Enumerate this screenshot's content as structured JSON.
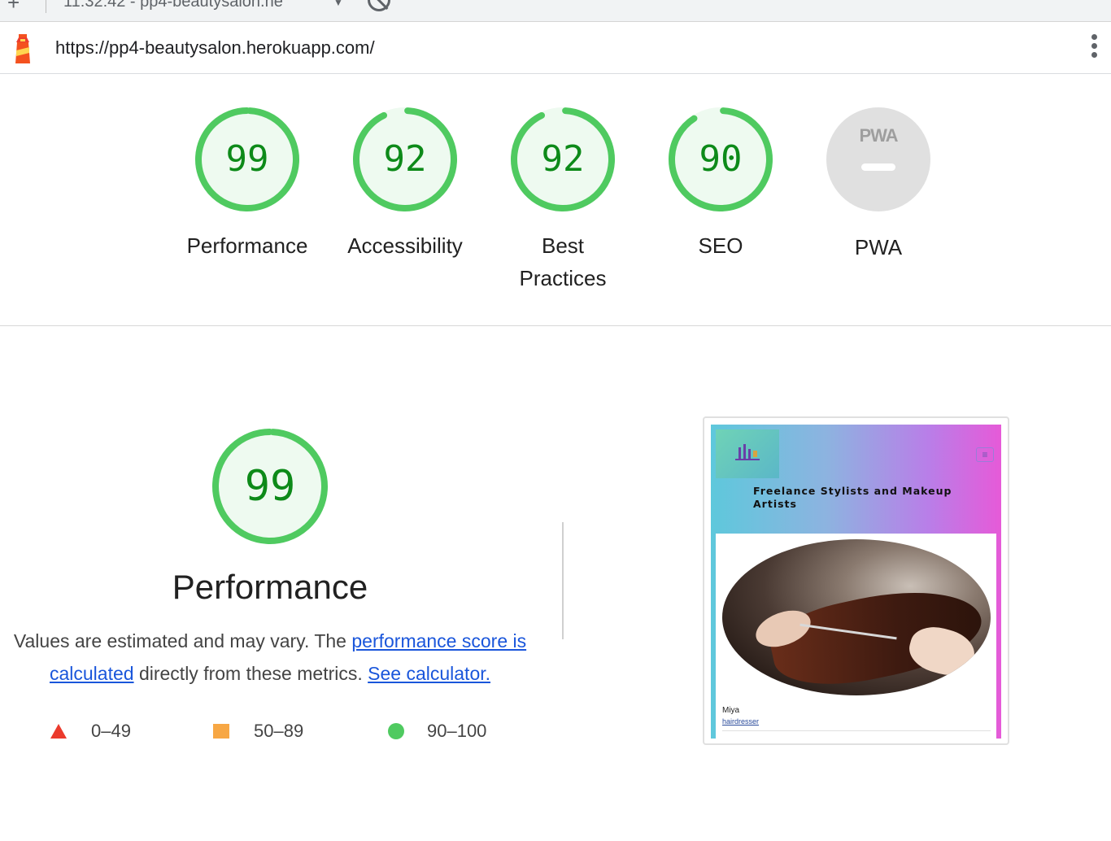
{
  "browser": {
    "tab_title": "11:32:42 - pp4-beautysalon.he",
    "new_tab_symbol": "+",
    "caret_symbol": "▼",
    "url": "https://pp4-beautysalon.herokuapp.com/",
    "icons": {
      "logo": "lighthouse-icon",
      "menu": "more-vert-icon",
      "blocked": "block-icon"
    }
  },
  "categories": [
    {
      "label": "Performance",
      "score": "99",
      "fraction": 0.99
    },
    {
      "label": "Accessibility",
      "score": "92",
      "fraction": 0.92
    },
    {
      "label": "Best Practices",
      "score": "92",
      "fraction": 0.92
    },
    {
      "label": "SEO",
      "score": "90",
      "fraction": 0.9
    },
    {
      "label": "PWA",
      "score": "",
      "badge": "PWA"
    }
  ],
  "performance": {
    "score": "99",
    "fraction": 0.99,
    "title": "Performance",
    "desc_prefix": "Values are estimated and may vary. The ",
    "desc_link1": "performance score is calculated",
    "desc_middle": " directly from these metrics. ",
    "desc_link2": "See calculator."
  },
  "legend": [
    {
      "range": "0–49",
      "shape": "triangle",
      "color": "#eb3a2c"
    },
    {
      "range": "50–89",
      "shape": "square",
      "color": "#f7a744"
    },
    {
      "range": "90–100",
      "shape": "circle",
      "color": "#4fca60"
    }
  ],
  "screenshot": {
    "heading": "Freelance Stylists and Makeup Artists",
    "menu_symbol": "≡",
    "card_name": "Miya",
    "card_role": "hairdresser"
  },
  "colors": {
    "pass": "#0d8a19",
    "pass_ring": "#4fca60",
    "pass_fill": "#eefaf0",
    "link": "#1a56db"
  }
}
